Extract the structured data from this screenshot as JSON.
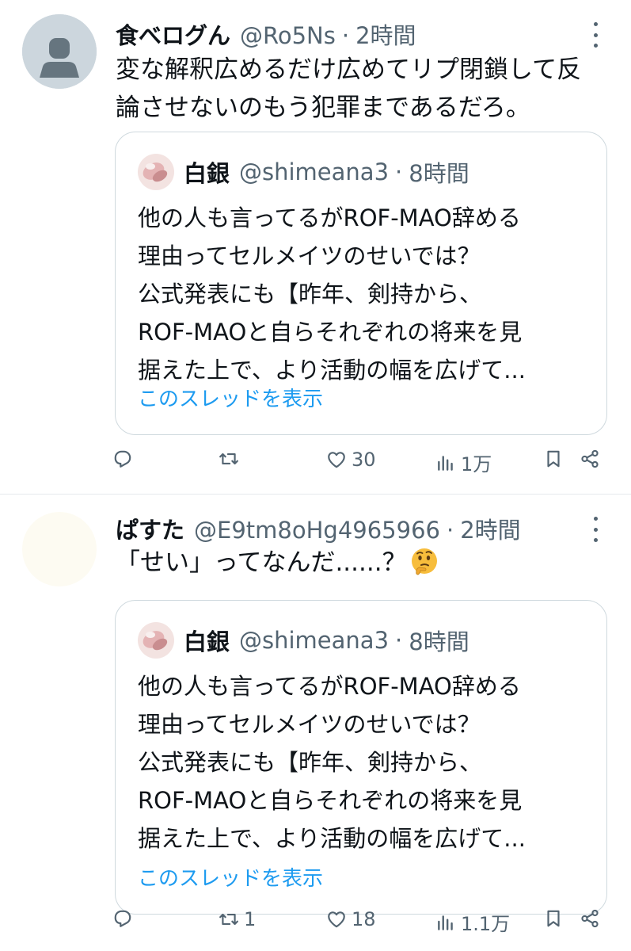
{
  "tweets": [
    {
      "author": {
        "name": "食べログん",
        "handle": "@Ro5Ns",
        "avatar": "default-avatar"
      },
      "separator": "·",
      "time": "2時間",
      "text": "変な解釈広めるだけ広めてリプ閉鎖して反\n論させないのもう犯罪まであるだろ。",
      "emoji": "",
      "quote": {
        "author": {
          "name": "白銀",
          "handle": "@shimeana3"
        },
        "separator": "·",
        "time": "8時間",
        "text": "他の人も言ってるがROF-MAO辞める\n理由ってセルメイツのせいでは？\n公式発表にも【昨年、剣持から、\nROF-MAOと自らそれぞれの将来を見\n据えた上で、より活動の幅を広げて...",
        "show_thread": "このスレッドを表示"
      },
      "actions": {
        "reply": "",
        "retweet": "",
        "like": "30",
        "views": "1万"
      }
    },
    {
      "author": {
        "name": "ぱすた",
        "handle": "@E9tm8oHg4965966",
        "avatar": "blank-avatar"
      },
      "separator": "·",
      "time": "2時間",
      "text": "「せい」ってなんだ......？",
      "emoji": "thinking-face",
      "quote": {
        "author": {
          "name": "白銀",
          "handle": "@shimeana3"
        },
        "separator": "·",
        "time": "8時間",
        "text": "他の人も言ってるがROF-MAO辞める\n理由ってセルメイツのせいでは？\n公式発表にも【昨年、剣持から、\nROF-MAOと自らそれぞれの将来を見\n据えた上で、より活動の幅を広げて...",
        "show_thread": "このスレッドを表示"
      },
      "actions": {
        "reply": "",
        "retweet": "1",
        "like": "18",
        "views": "1.1万"
      }
    }
  ],
  "colors": {
    "link": "#1d9bf0",
    "secondary": "#536471",
    "border": "#cfd9de",
    "text": "#0f1419"
  }
}
